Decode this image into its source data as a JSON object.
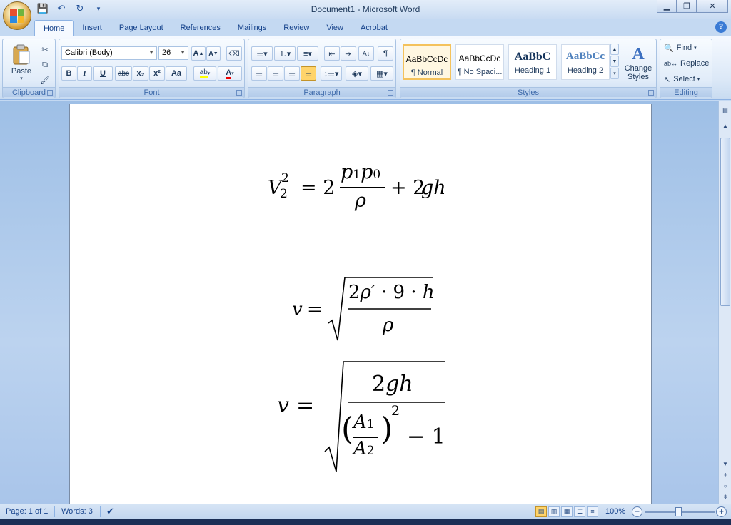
{
  "window": {
    "title": "Document1 - Microsoft Word"
  },
  "qat": {
    "save_icon": "save-icon",
    "undo_icon": "undo-icon",
    "redo_icon": "redo-icon"
  },
  "tabs": [
    {
      "label": "Home",
      "active": true
    },
    {
      "label": "Insert"
    },
    {
      "label": "Page Layout"
    },
    {
      "label": "References"
    },
    {
      "label": "Mailings"
    },
    {
      "label": "Review"
    },
    {
      "label": "View"
    },
    {
      "label": "Acrobat"
    }
  ],
  "clipboard": {
    "paste_label": "Paste",
    "group_label": "Clipboard"
  },
  "font": {
    "font_name": "Calibri (Body)",
    "font_size": "26",
    "group_label": "Font",
    "bold": "B",
    "italic": "I",
    "underline": "U",
    "strike": "abc",
    "sub": "x₂",
    "sup": "x²",
    "case": "Aa"
  },
  "paragraph": {
    "group_label": "Paragraph"
  },
  "styles": {
    "group_label": "Styles",
    "items": [
      {
        "sample": "AaBbCcDc",
        "name": "¶ Normal",
        "selected": true
      },
      {
        "sample": "AaBbCcDc",
        "name": "¶ No Spaci..."
      },
      {
        "sample": "AaBbC",
        "name": "Heading 1"
      },
      {
        "sample": "AaBbCc",
        "name": "Heading 2"
      }
    ],
    "change_styles": "Change Styles"
  },
  "editing": {
    "group_label": "Editing",
    "find": "Find",
    "replace": "Replace",
    "select": "Select"
  },
  "status": {
    "page": "Page: 1 of 1",
    "words": "Words: 3",
    "zoom": "100%"
  },
  "colors": {
    "accent": "#15428b",
    "ribbon_bg": "#dbe8f7"
  }
}
